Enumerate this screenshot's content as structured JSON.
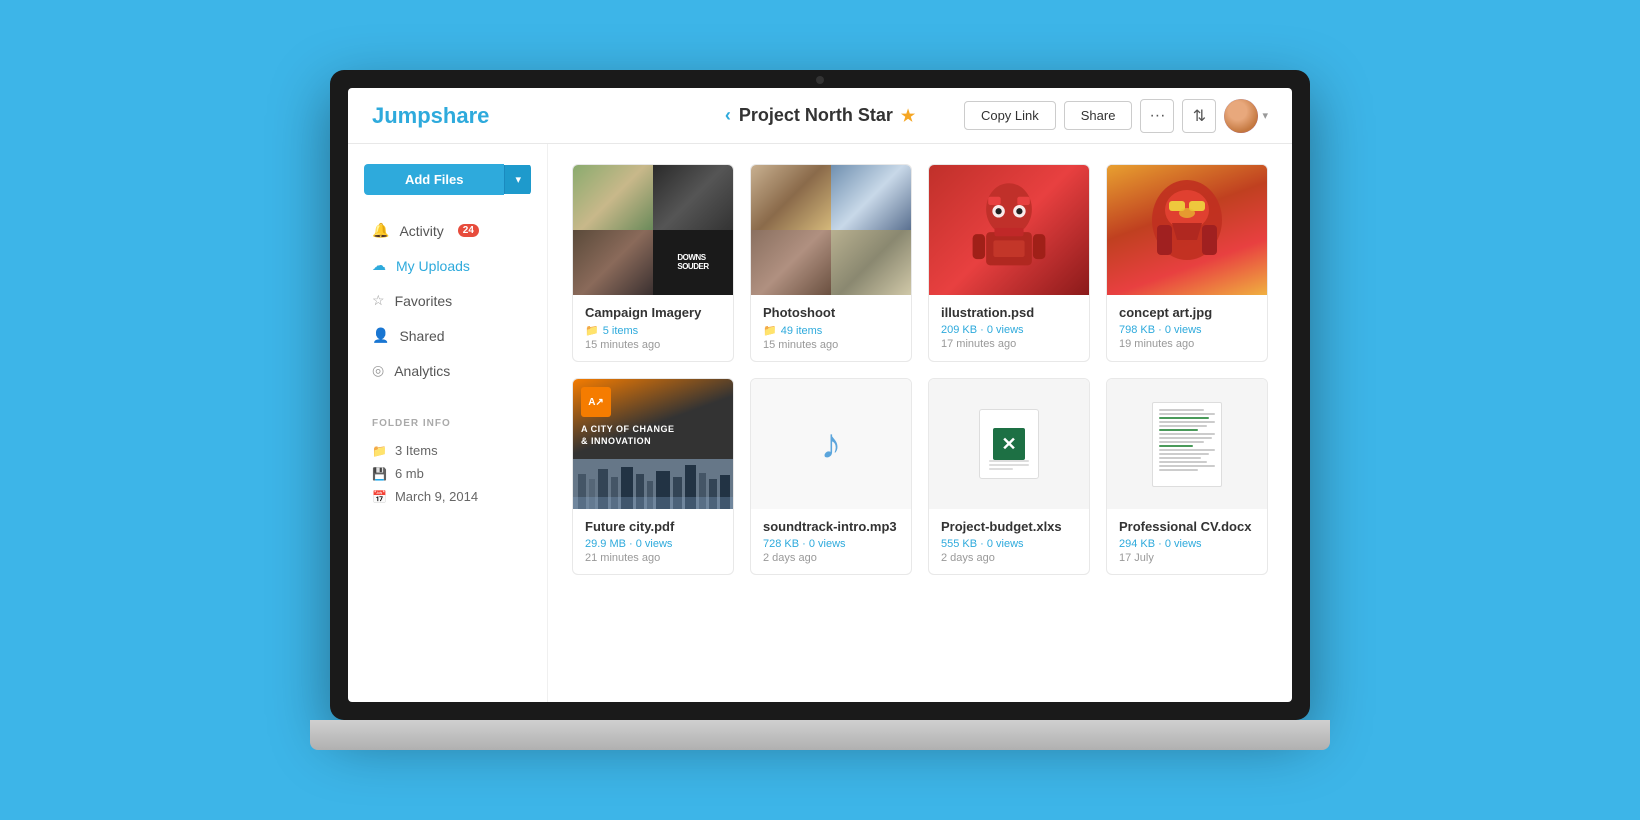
{
  "app": {
    "logo": "Jumpshare",
    "header": {
      "back_label": "‹",
      "folder_title": "Project North Star",
      "star_icon": "★",
      "copy_link_label": "Copy Link",
      "share_label": "Share",
      "more_icon": "•••",
      "sort_icon": "⇅"
    }
  },
  "sidebar": {
    "add_files_label": "Add Files",
    "add_files_dropdown": "▾",
    "nav_items": [
      {
        "id": "activity",
        "label": "Activity",
        "icon": "🔔",
        "badge": "24"
      },
      {
        "id": "my-uploads",
        "label": "My Uploads",
        "icon": "☁",
        "active": true
      },
      {
        "id": "favorites",
        "label": "Favorites",
        "icon": "☆"
      },
      {
        "id": "shared",
        "label": "Shared",
        "icon": "👤"
      },
      {
        "id": "analytics",
        "label": "Analytics",
        "icon": "◎"
      }
    ],
    "folder_info": {
      "title": "FOLDER INFO",
      "items_label": "3 Items",
      "size_label": "6 mb",
      "date_label": "March 9, 2014",
      "items_icon": "📁",
      "size_icon": "💾",
      "date_icon": "📅"
    }
  },
  "files": [
    {
      "id": "campaign-imagery",
      "name": "Campaign Imagery",
      "type": "folder",
      "meta": "5 items",
      "date": "15 minutes ago",
      "thumb_type": "campaign"
    },
    {
      "id": "photoshoot",
      "name": "Photoshoot",
      "type": "folder",
      "meta": "49 items",
      "date": "15 minutes ago",
      "thumb_type": "photoshoot"
    },
    {
      "id": "illustration-psd",
      "name": "illustration.psd",
      "type": "image",
      "meta": "209 KB · 0 views",
      "date": "17 minutes ago",
      "thumb_type": "illustration"
    },
    {
      "id": "concept-art-jpg",
      "name": "concept art.jpg",
      "type": "image",
      "meta": "798 KB · 0 views",
      "date": "19 minutes ago",
      "thumb_type": "concept-art"
    },
    {
      "id": "future-city-pdf",
      "name": "Future city.pdf",
      "type": "pdf",
      "meta": "29.9 MB · 0 views",
      "date": "21 minutes ago",
      "thumb_type": "pdf"
    },
    {
      "id": "soundtrack-intro-mp3",
      "name": "soundtrack-intro.mp3",
      "type": "audio",
      "meta": "728 KB · 0 views",
      "date": "2 days ago",
      "thumb_type": "mp3"
    },
    {
      "id": "project-budget-xlxs",
      "name": "Project-budget.xlxs",
      "type": "spreadsheet",
      "meta": "555 KB · 0 views",
      "date": "2 days ago",
      "thumb_type": "xlsx"
    },
    {
      "id": "professional-cv-docx",
      "name": "Professional CV.docx",
      "type": "document",
      "meta": "294 KB · 0 views",
      "date": "17 July",
      "thumb_type": "docx"
    }
  ]
}
